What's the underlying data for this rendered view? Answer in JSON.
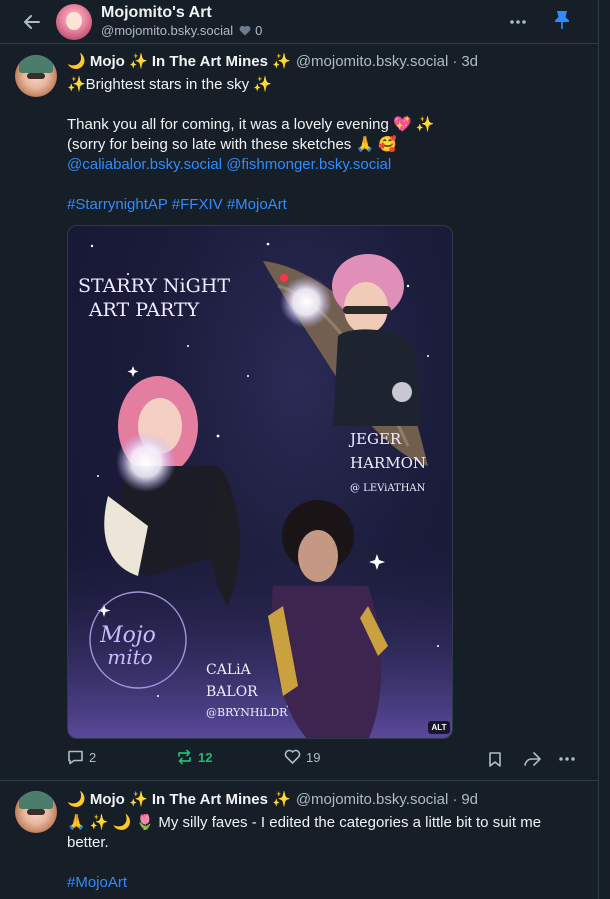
{
  "header": {
    "title": "Mojomito's Art",
    "handle": "@mojomito.bsky.social",
    "likes_count": "0"
  },
  "posts": [
    {
      "author_name": "🌙 Mojo ✨ In The Art Mines ✨",
      "author_handle": "@mojomito.bsky.social",
      "separator": "·",
      "time": "3d",
      "lines": [
        "✨Brightest stars in the sky ✨",
        "Thank you all for coming, it was a lovely evening 💖 ✨",
        "(sorry for being so late with these sketches 🙏 🥰"
      ],
      "mentions": [
        "@caliabalor.bsky.social",
        "@fishmonger.bsky.social"
      ],
      "hashtags": [
        "#StarrynightAP",
        "#FFXIV",
        "#MojoArt"
      ],
      "image": {
        "title_line1": "STARRY NiGHT",
        "title_line2": "ART PARTY",
        "char1_line1": "JEGER",
        "char1_line2": "HARMON",
        "char1_server": "@ LEViATHAN",
        "char2_line1": "CALiA",
        "char2_line2": "BALOR",
        "char2_server": "@BRYNHiLDR",
        "logo_line1": "Mojo",
        "logo_line2": "mito",
        "alt_label": "ALT"
      },
      "counts": {
        "replies": "2",
        "reposts": "12",
        "likes": "19"
      }
    },
    {
      "author_name": "🌙 Mojo ✨ In The Art Mines ✨",
      "author_handle": "@mojomito.bsky.social",
      "separator": "·",
      "time": "9d",
      "lines": [
        "🙏 ✨ 🌙 🌷  My silly faves - I edited the categories a little bit to suit me",
        "better."
      ],
      "hashtags": [
        "#MojoArt"
      ]
    }
  ],
  "colors": {
    "background": "#161e27",
    "border": "#2e3a48",
    "text": "#f1f3f5",
    "muted": "#aebbc9",
    "link": "#2f8cff",
    "repost": "#20bc6e"
  }
}
